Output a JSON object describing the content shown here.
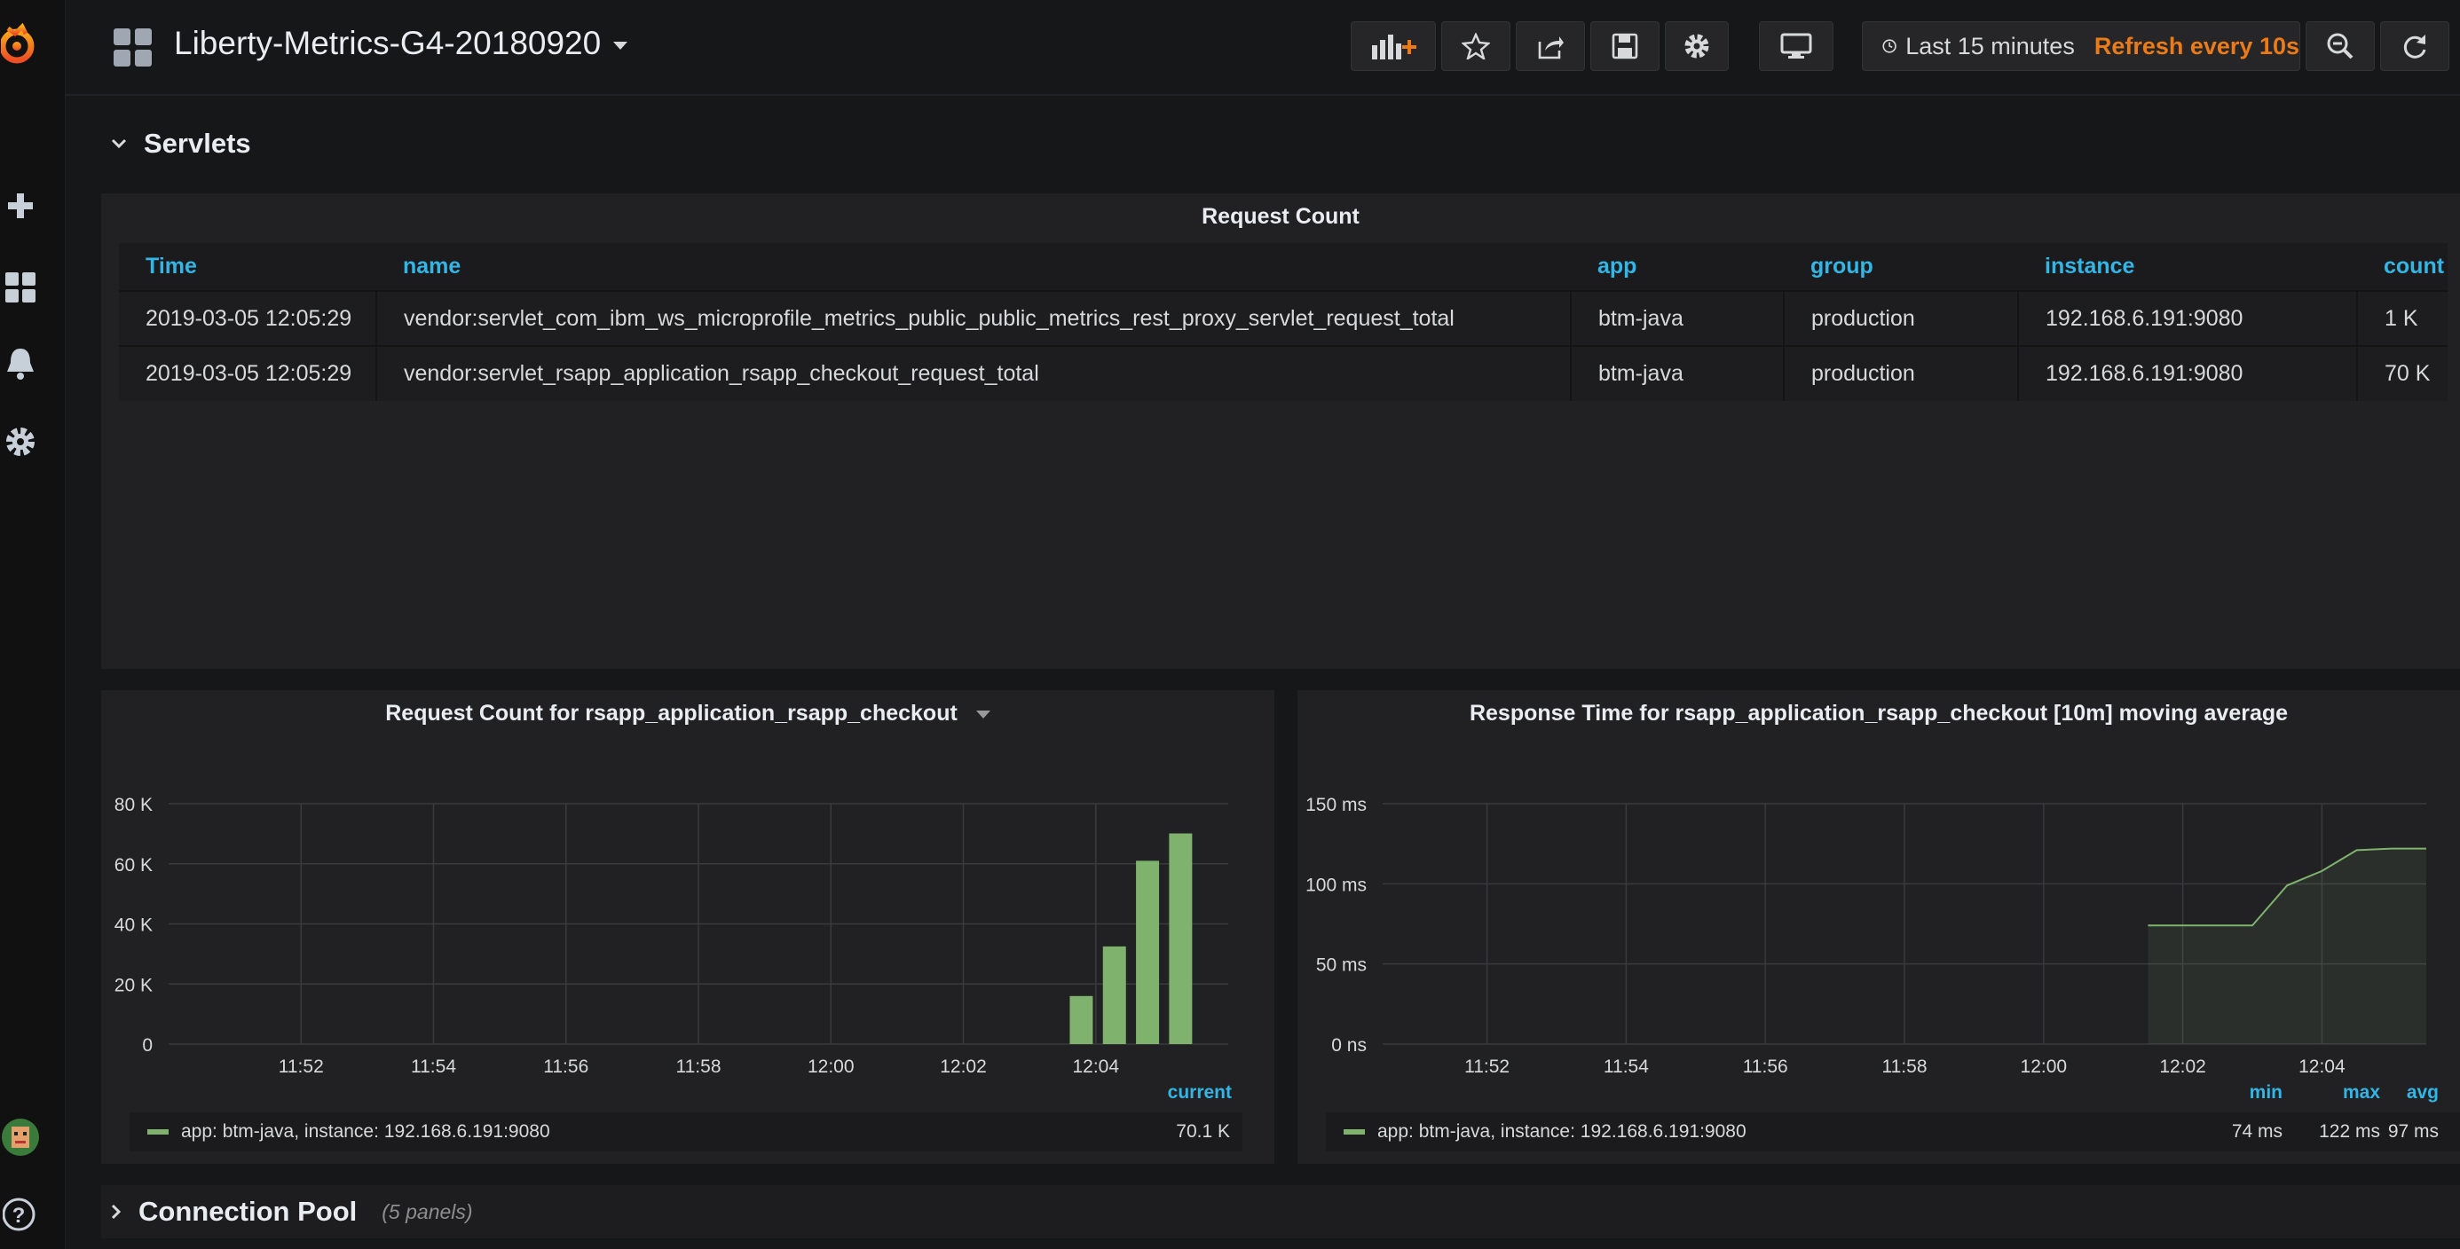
{
  "topnav": {
    "dashboard_title": "Liberty-Metrics-G4-20180920",
    "time_range": "Last 15 minutes",
    "refresh": "Refresh every 10s"
  },
  "servlets_row": {
    "title": "Servlets"
  },
  "request_table": {
    "title": "Request Count",
    "columns": [
      "Time",
      "name",
      "app",
      "group",
      "instance",
      "count"
    ],
    "rows": [
      [
        "2019-03-05 12:05:29",
        "vendor:servlet_com_ibm_ws_microprofile_metrics_public_public_metrics_rest_proxy_servlet_request_total",
        "btm-java",
        "production",
        "192.168.6.191:9080",
        "1 K"
      ],
      [
        "2019-03-05 12:05:29",
        "vendor:servlet_rsapp_application_rsapp_checkout_request_total",
        "btm-java",
        "production",
        "192.168.6.191:9080",
        "70 K"
      ]
    ]
  },
  "chart_data": [
    {
      "type": "bar",
      "title": "Request Count for rsapp_application_rsapp_checkout",
      "x_ticks": [
        "11:52",
        "11:54",
        "11:56",
        "11:58",
        "12:00",
        "12:02",
        "12:04"
      ],
      "y_ticks": [
        "0",
        "20 K",
        "40 K",
        "60 K",
        "80 K"
      ],
      "ylim": [
        0,
        80000
      ],
      "x_range_minutes": [
        "11:50:30",
        "12:05:30"
      ],
      "series": [
        {
          "name": "app: btm-java, instance: 192.168.6.191:9080",
          "x": [
            "12:04:00",
            "12:04:30",
            "12:05:00",
            "12:05:30"
          ],
          "values": [
            16000,
            32500,
            61000,
            70100
          ]
        }
      ],
      "legend": {
        "header": "current",
        "current": "70.1 K"
      },
      "grid": true,
      "color": "#7eb26d"
    },
    {
      "type": "area",
      "title": "Response Time for rsapp_application_rsapp_checkout [10m] moving average",
      "x_ticks": [
        "11:52",
        "11:54",
        "11:56",
        "11:58",
        "12:00",
        "12:02",
        "12:04"
      ],
      "y_ticks": [
        "0 ns",
        "50 ms",
        "100 ms",
        "150 ms"
      ],
      "ylim": [
        0,
        150
      ],
      "series": [
        {
          "name": "app: btm-java, instance: 192.168.6.191:9080",
          "x": [
            "12:01:30",
            "12:02:00",
            "12:02:30",
            "12:03:00",
            "12:03:30",
            "12:04:00",
            "12:04:30",
            "12:05:00",
            "12:05:30"
          ],
          "values": [
            74,
            74,
            74,
            74,
            99,
            108,
            121,
            122,
            122
          ]
        }
      ],
      "legend": {
        "headers": [
          "min",
          "max",
          "avg"
        ],
        "min": "74 ms",
        "max": "122 ms",
        "avg": "97 ms"
      },
      "grid": true,
      "color": "#7eb26d"
    }
  ],
  "connection_pool_row": {
    "title": "Connection Pool",
    "subtitle": "(5 panels)"
  }
}
